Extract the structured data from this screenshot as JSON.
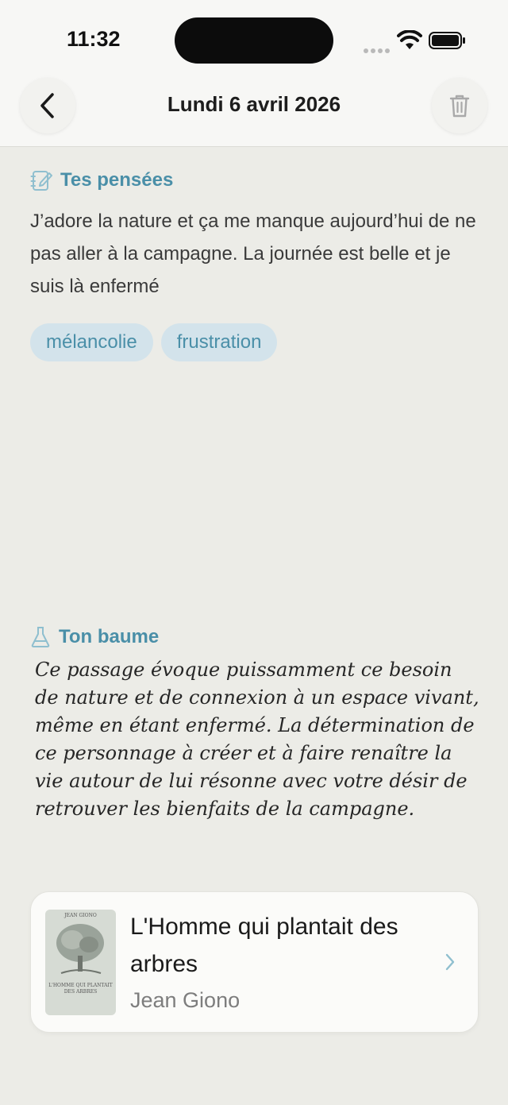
{
  "status_bar": {
    "time": "11:32"
  },
  "header": {
    "title": "Lundi 6 avril 2026"
  },
  "thoughts": {
    "section_title": "Tes pensées",
    "text": "J’adore la nature et ça me manque aujourd’hui de ne pas aller à la campagne. La journée est belle et je suis là enfermé",
    "tags": [
      "mélancolie",
      "frustration"
    ]
  },
  "balm": {
    "section_title": "Ton baume",
    "text": "Ce passage évoque puissamment ce besoin de nature et de connexion à un espace vivant, même en étant enfermé. La détermination de ce personnage à créer et à faire renaître la vie autour de lui résonne avec votre désir de retrouver les bienfaits de la campagne."
  },
  "book": {
    "title": "L'Homme qui plantait des arbres",
    "author": "Jean Giono",
    "cover_author": "JEAN GIONO",
    "cover_title": "L'HOMME QUI PLANTAIT DES ARBRES"
  },
  "colors": {
    "accent": "#4a8fa8",
    "tag_bg": "#d3e3eb",
    "background": "#ecece7"
  },
  "icons": [
    "chevron-left-icon",
    "trash-icon",
    "journal-edit-icon",
    "flask-icon",
    "chevron-right-icon",
    "wifi-icon",
    "battery-icon"
  ]
}
